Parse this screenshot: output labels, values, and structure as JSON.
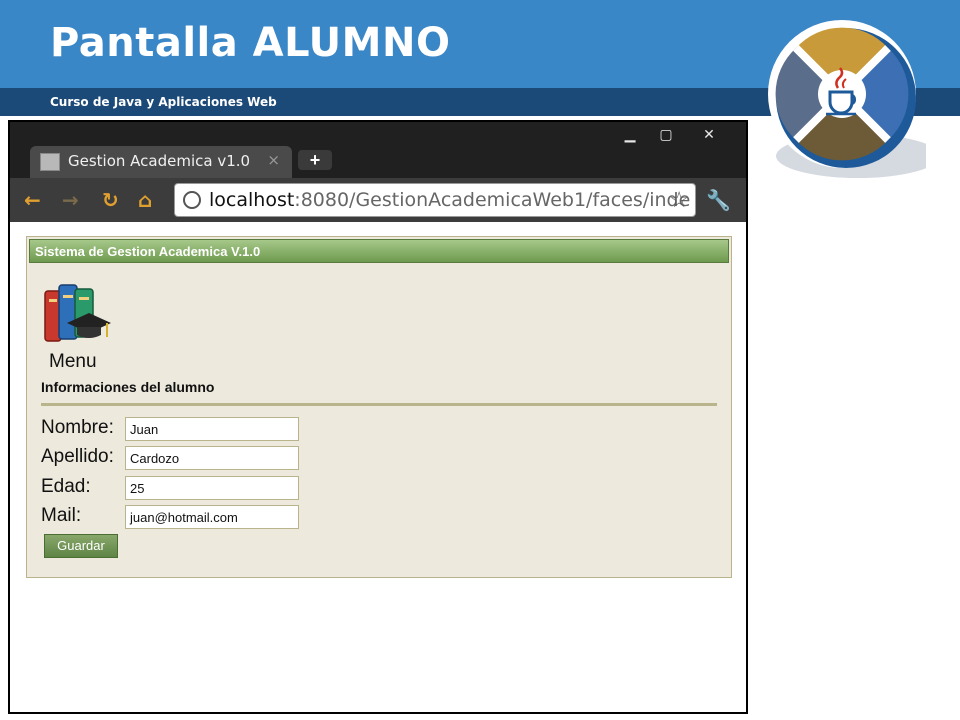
{
  "slide": {
    "title": "Pantalla ALUMNO",
    "subtitle": "Curso de Java y Aplicaciones Web"
  },
  "logo": {
    "icon": "java-cup-icon"
  },
  "colors": {
    "header_blue": "#3a87c8",
    "subbar_navy": "#1c4a78",
    "panel_bg": "#ede9dd",
    "panel_header_green": "#6e9a4e"
  },
  "browser": {
    "window_controls": {
      "minimize": "▁",
      "maximize": "▢",
      "close": "✕"
    },
    "tab": {
      "title": "Gestion Academica v1.0",
      "close": "×"
    },
    "new_tab": "+",
    "nav": {
      "back": "←",
      "forward": "→",
      "reload": "↻",
      "home": "⌂"
    },
    "url": {
      "host": "localhost",
      "path": ":8080/GestionAcademicaWeb1/faces/inde"
    },
    "star": "☆",
    "wrench": "🔧"
  },
  "page": {
    "header": "Sistema de Gestion Academica V.1.0",
    "menu_label": "Menu",
    "section_title": "Informaciones del alumno",
    "form": {
      "nombre_label": "Nombre:",
      "nombre_value": "Juan",
      "apellido_label": "Apellido:",
      "apellido_value": "Cardozo",
      "edad_label": "Edad:",
      "edad_value": "25",
      "mail_label": "Mail:",
      "mail_value": "juan@hotmail.com",
      "save_label": "Guardar"
    }
  }
}
